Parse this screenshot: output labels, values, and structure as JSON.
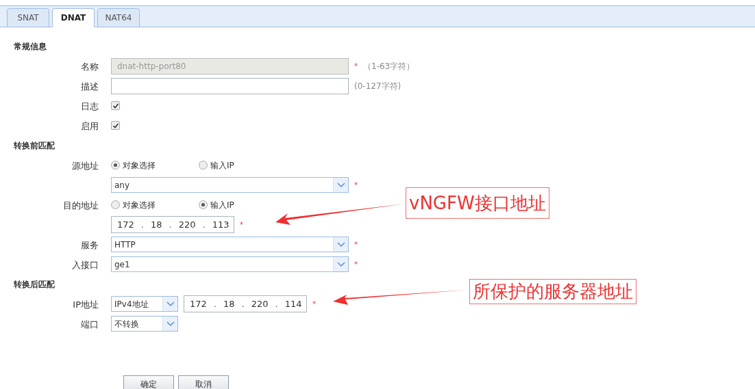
{
  "tabs": [
    {
      "label": "SNAT",
      "selected": false
    },
    {
      "label": "DNAT",
      "selected": true
    },
    {
      "label": "NAT64",
      "selected": false
    }
  ],
  "sections": [
    {
      "title": "常规信息",
      "rows": [
        {
          "kind": "text",
          "label": "名称",
          "value": "dnat-http-port80",
          "disabled": true,
          "required_mark": "*",
          "hint": "（1-63字符）"
        },
        {
          "kind": "text",
          "label": "描述",
          "value": "",
          "disabled": false,
          "hint": "(0-127字符)"
        },
        {
          "kind": "checkbox",
          "label": "日志",
          "checked": true
        },
        {
          "kind": "checkbox",
          "label": "启用",
          "checked": true
        }
      ]
    },
    {
      "title": "转换前匹配",
      "rows": [
        {
          "kind": "radio",
          "label": "源地址",
          "options": [
            {
              "label": "对象选择",
              "selected": true
            },
            {
              "label": "输入IP",
              "selected": false
            }
          ]
        },
        {
          "kind": "select",
          "value": "any",
          "required_mark": "*"
        },
        {
          "kind": "radio",
          "label": "目的地址",
          "options": [
            {
              "label": "对象选择",
              "selected": false
            },
            {
              "label": "输入IP",
              "selected": true
            }
          ]
        },
        {
          "kind": "ip",
          "parts": [
            "172",
            ".",
            "18",
            ".",
            "220",
            ".",
            "113"
          ],
          "required_mark": "*"
        },
        {
          "kind": "select",
          "label": "服务",
          "value": "HTTP",
          "required_mark": "*"
        },
        {
          "kind": "select",
          "label": "入接口",
          "value": "ge1",
          "required_mark": "*"
        }
      ]
    },
    {
      "title": "转换后匹配",
      "rows": [
        {
          "kind": "select_ip",
          "label": "IP地址",
          "value": "IPv4地址",
          "parts": [
            "172",
            ".",
            "18",
            ".",
            "220",
            ".",
            "114"
          ],
          "required_mark": "*"
        },
        {
          "kind": "short_select",
          "label": "端口",
          "value": "不转换"
        }
      ]
    }
  ],
  "buttons": [
    "确定",
    "取消"
  ],
  "callouts": [
    {
      "text": "vNGFW接口地址"
    },
    {
      "text": "所保护的服务器地址"
    }
  ]
}
